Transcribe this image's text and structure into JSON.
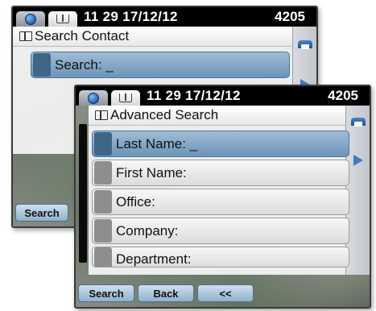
{
  "back_screen": {
    "status": {
      "time": "11 29 17/12/12",
      "extension": "4205"
    },
    "title": "Search Contact",
    "search_row": "Search: _",
    "softkeys": [
      "Search"
    ]
  },
  "front_screen": {
    "status": {
      "time": "11 29 17/12/12",
      "extension": "4205"
    },
    "title": "Advanced Search",
    "fields": [
      "Last Name: _",
      "First Name:",
      "Office:",
      "Company:",
      "Department:"
    ],
    "softkeys": [
      "Search",
      "Back",
      "<<"
    ]
  },
  "icons": {
    "tab1": "globe-icon",
    "tab2": "directory-book-icon",
    "side1": "handset-icon",
    "side2": "arrow-right-icon"
  },
  "colors": {
    "selected_row": "#7fa3c4",
    "softkey": "#a9c4dc",
    "status_bar": "#000000"
  }
}
